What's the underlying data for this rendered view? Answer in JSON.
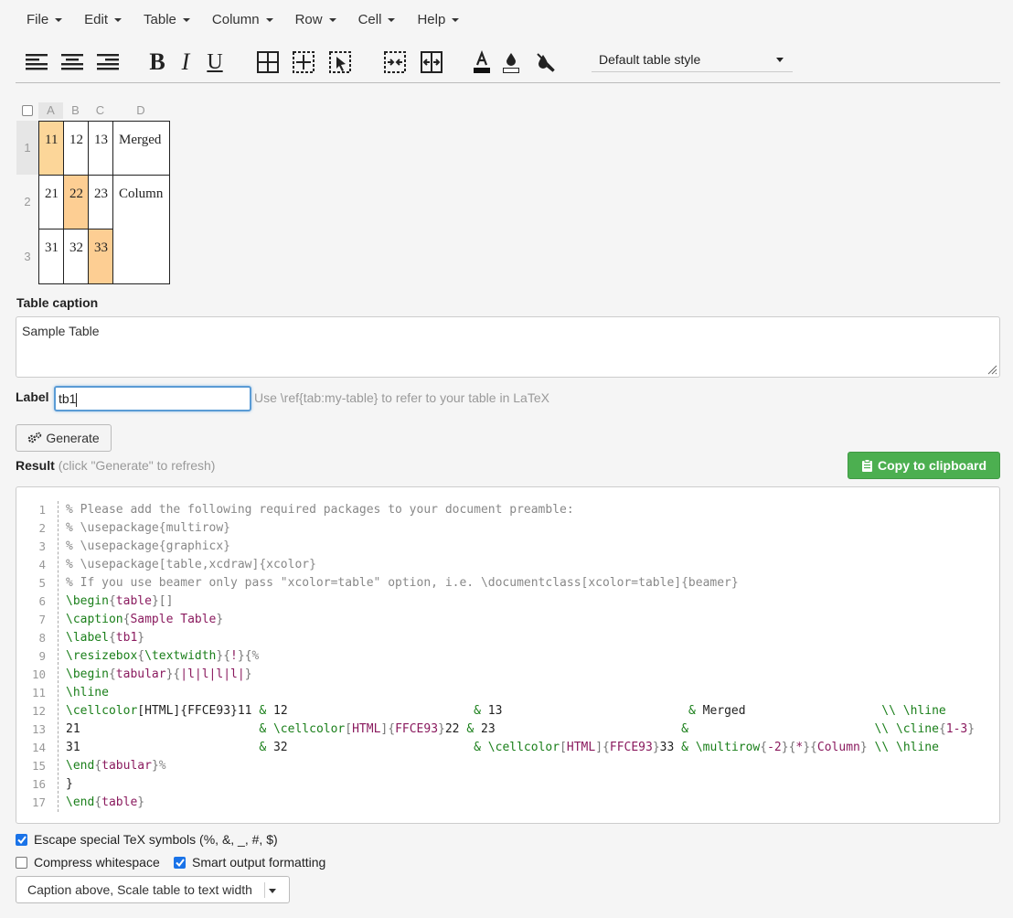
{
  "menu": [
    "File",
    "Edit",
    "Table",
    "Column",
    "Row",
    "Cell",
    "Help"
  ],
  "toolbar": {
    "icons": [
      "align-left-icon",
      "align-center-icon",
      "align-right-icon",
      "bold-icon",
      "italic-icon",
      "underline-icon",
      "all-borders-icon",
      "inner-borders-icon",
      "remove-borders-icon",
      "merge-cells-icon",
      "split-cells-icon",
      "text-color-icon",
      "fill-color-icon",
      "clear-format-icon"
    ],
    "bold": "B",
    "italic": "I",
    "underline": "U",
    "style_select": "Default table style"
  },
  "grid": {
    "columns": [
      "A",
      "B",
      "C",
      "D"
    ],
    "rows": [
      "1",
      "2",
      "3"
    ],
    "cells": {
      "r1": [
        "11",
        "12",
        "13",
        "Merged"
      ],
      "r2": [
        "21",
        "22",
        "23",
        "Column"
      ],
      "r3": [
        "31",
        "32",
        "33"
      ]
    },
    "highlight_color": "#FFCE93"
  },
  "caption": {
    "label": "Table caption",
    "value": "Sample Table"
  },
  "label_field": {
    "label": "Label",
    "value": "tb1",
    "hint": "Use \\ref{tab:my-table} to refer to your table in LaTeX"
  },
  "generate_button": "Generate",
  "result": {
    "label": "Result",
    "note": "(click \"Generate\" to refresh)"
  },
  "copy_button": "Copy to clipboard",
  "code_line_numbers": [
    "1",
    "2",
    "3",
    "4",
    "5",
    "6",
    "7",
    "8",
    "9",
    "10",
    "11",
    "12",
    "13",
    "14",
    "15",
    "16",
    "17"
  ],
  "options": {
    "escape": {
      "label": "Escape special TeX symbols (%, &, _, #, $)",
      "checked": true
    },
    "compress": {
      "label": "Compress whitespace",
      "checked": false
    },
    "smart": {
      "label": "Smart output formatting",
      "checked": true
    }
  },
  "caption_mode": "Caption above, Scale table to text width",
  "colors": {
    "accent_green": "#4CAF50",
    "focus_blue": "#5A9BD5",
    "checkbox_blue": "#1A73E8"
  }
}
